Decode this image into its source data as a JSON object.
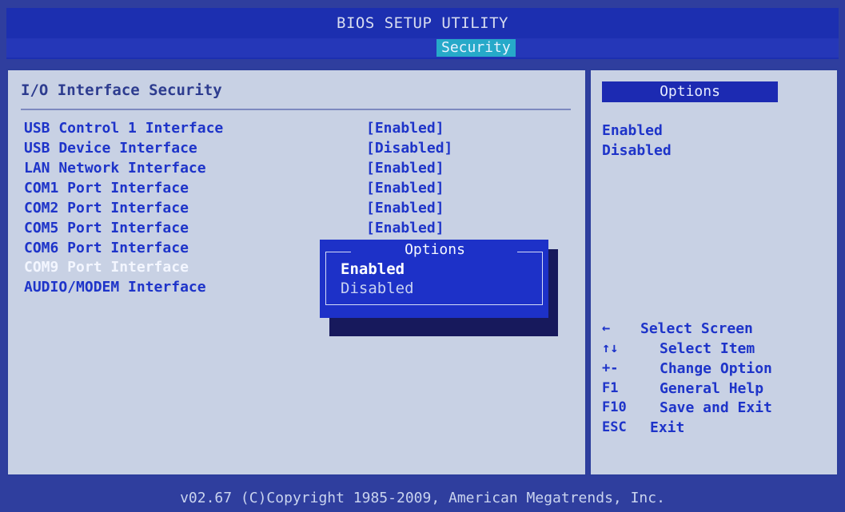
{
  "header": {
    "title": "BIOS SETUP UTILITY",
    "active_tab": "Security"
  },
  "main": {
    "section_title": "I/O Interface Security",
    "settings": [
      {
        "label": "USB Control 1 Interface",
        "value": "[Enabled]"
      },
      {
        "label": "USB Device Interface",
        "value": "[Disabled]"
      },
      {
        "label": "LAN Network Interface",
        "value": "[Enabled]"
      },
      {
        "label": "COM1 Port Interface",
        "value": "[Enabled]"
      },
      {
        "label": "COM2 Port Interface",
        "value": "[Enabled]"
      },
      {
        "label": "COM5 Port Interface",
        "value": "[Enabled]"
      },
      {
        "label": "COM6 Port Interface",
        "value": ""
      },
      {
        "label": "COM9 Port Interface",
        "value": ""
      },
      {
        "label": "AUDIO/MODEM Interface",
        "value": ""
      }
    ],
    "selected_setting": "COM9 Port Interface"
  },
  "popup": {
    "title": "Options",
    "options": [
      "Enabled",
      "Disabled"
    ],
    "highlighted": "Enabled"
  },
  "right_panel": {
    "header": "Options",
    "options": [
      "Enabled",
      "Disabled"
    ],
    "help": [
      {
        "key": "←",
        "action": "Select Screen",
        "icon": "left-arrow-icon"
      },
      {
        "key": "↑↓",
        "action": "Select Item",
        "icon": "up-down-arrow-icon"
      },
      {
        "key": "+-",
        "action": "Change Option",
        "icon": "plus-minus-icon"
      },
      {
        "key": "F1",
        "action": "General Help"
      },
      {
        "key": "F10",
        "action": "Save and Exit"
      },
      {
        "key": "ESC",
        "action": "Exit"
      }
    ]
  },
  "footer": {
    "text": "v02.67 (C)Copyright 1985-2009, American Megatrends, Inc."
  },
  "colors": {
    "background": "#2f3e9e",
    "panel": "#c8d1e4",
    "text": "#1e34c9",
    "popup": "#1d31c8",
    "tab_highlight": "#26a9c9"
  }
}
